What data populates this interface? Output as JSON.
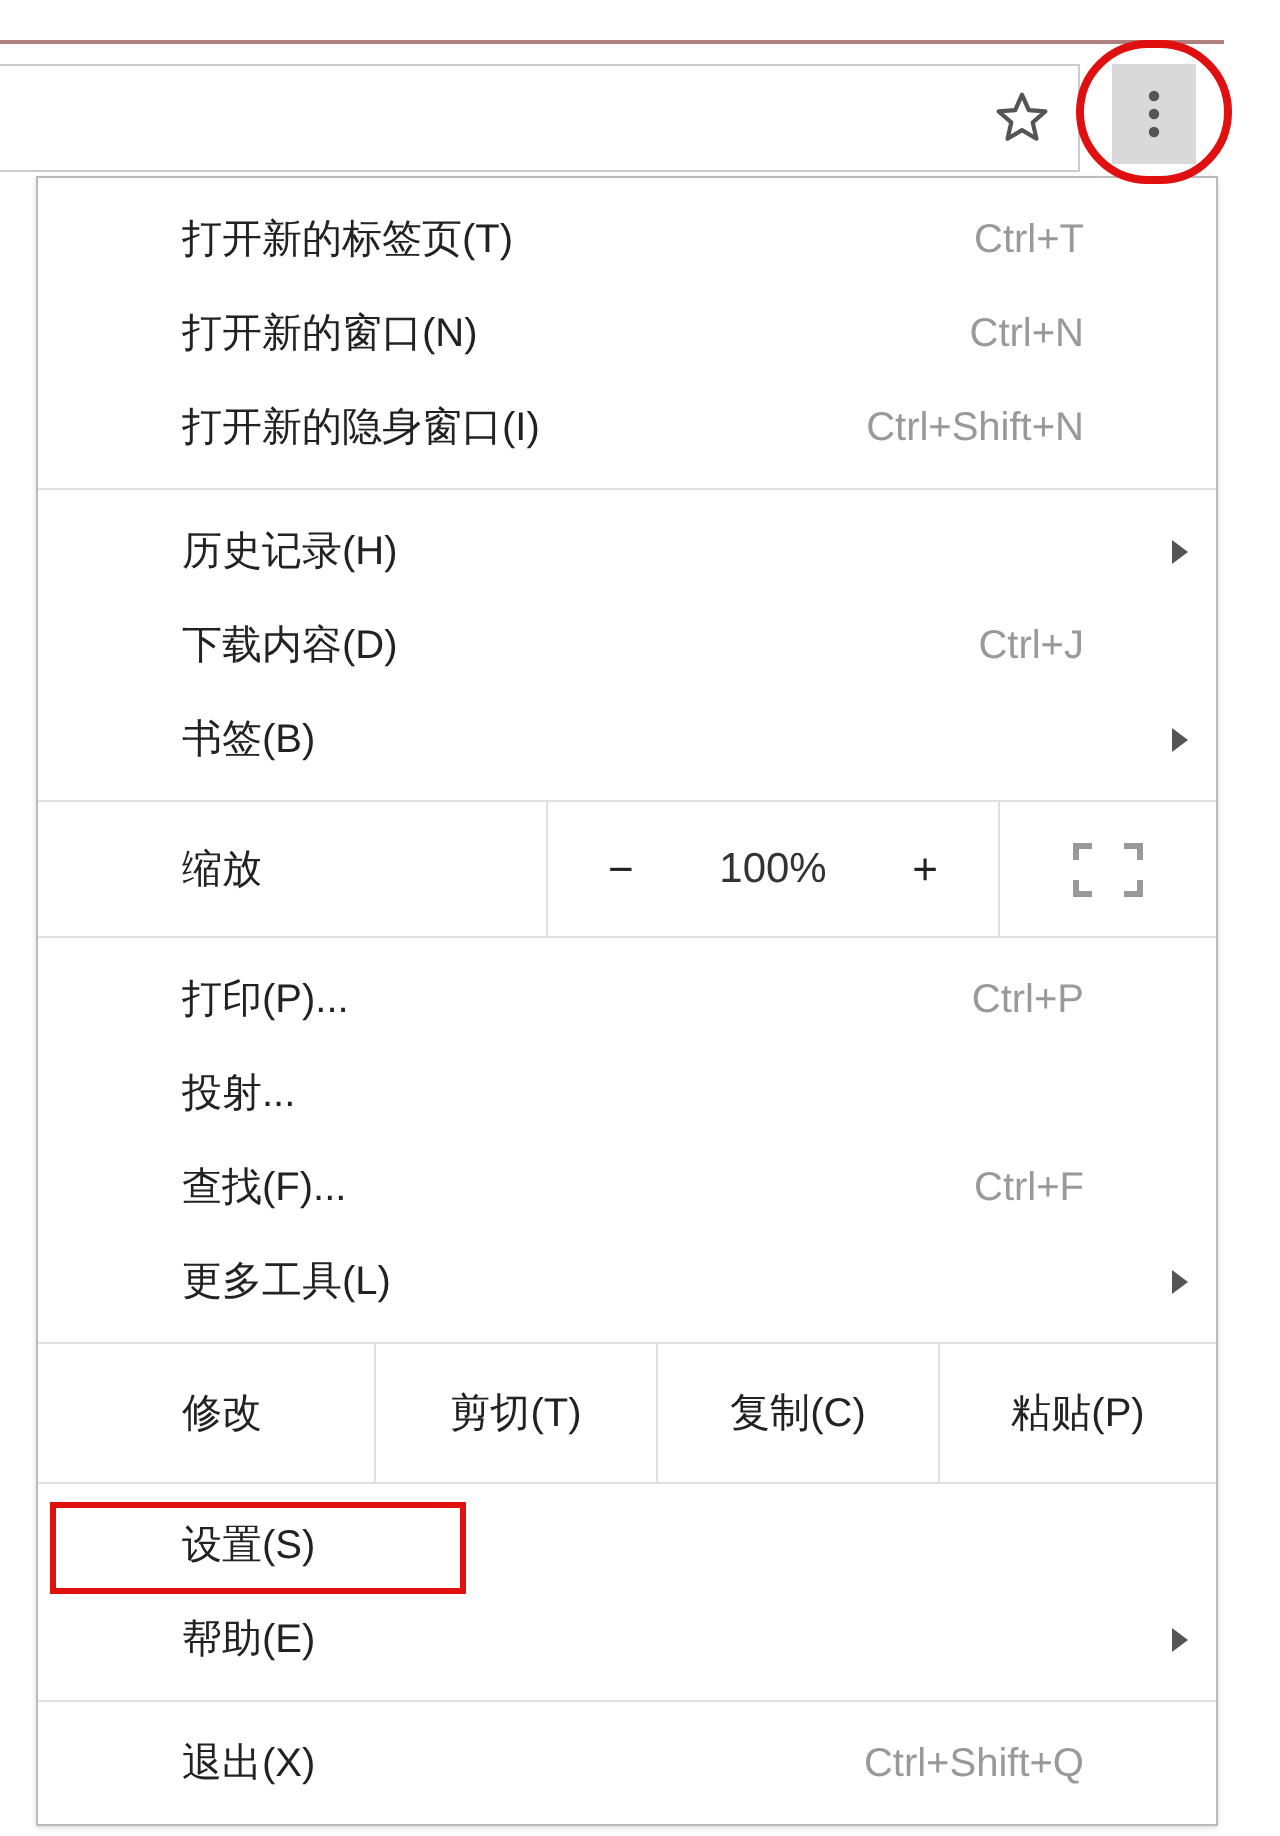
{
  "toolbar": {
    "menu_button": {
      "highlighted": true
    }
  },
  "menu": {
    "sections": [
      {
        "kind": "items",
        "items": [
          {
            "label": "打开新的标签页(T)",
            "shortcut": "Ctrl+T",
            "submenu": false,
            "highlighted": false
          },
          {
            "label": "打开新的窗口(N)",
            "shortcut": "Ctrl+N",
            "submenu": false,
            "highlighted": false
          },
          {
            "label": "打开新的隐身窗口(I)",
            "shortcut": "Ctrl+Shift+N",
            "submenu": false,
            "highlighted": false
          }
        ]
      },
      {
        "kind": "items",
        "items": [
          {
            "label": "历史记录(H)",
            "submenu": true,
            "highlighted": false
          },
          {
            "label": "下载内容(D)",
            "shortcut": "Ctrl+J",
            "submenu": false,
            "highlighted": false
          },
          {
            "label": "书签(B)",
            "submenu": true,
            "highlighted": false
          }
        ]
      },
      {
        "kind": "zoom",
        "label": "缩放",
        "minus": "−",
        "value": "100%",
        "plus": "+"
      },
      {
        "kind": "items",
        "items": [
          {
            "label": "打印(P)...",
            "shortcut": "Ctrl+P",
            "submenu": false,
            "highlighted": false
          },
          {
            "label": "投射...",
            "submenu": false,
            "highlighted": false
          },
          {
            "label": "查找(F)...",
            "shortcut": "Ctrl+F",
            "submenu": false,
            "highlighted": false
          },
          {
            "label": "更多工具(L)",
            "submenu": true,
            "highlighted": false
          }
        ]
      },
      {
        "kind": "edit",
        "label": "修改",
        "buttons": [
          "剪切(T)",
          "复制(C)",
          "粘贴(P)"
        ]
      },
      {
        "kind": "items",
        "items": [
          {
            "label": "设置(S)",
            "submenu": false,
            "highlighted": true
          },
          {
            "label": "帮助(E)",
            "submenu": true,
            "highlighted": false
          }
        ]
      },
      {
        "kind": "items",
        "items": [
          {
            "label": "退出(X)",
            "shortcut": "Ctrl+Shift+Q",
            "submenu": false,
            "highlighted": false
          }
        ]
      }
    ]
  }
}
